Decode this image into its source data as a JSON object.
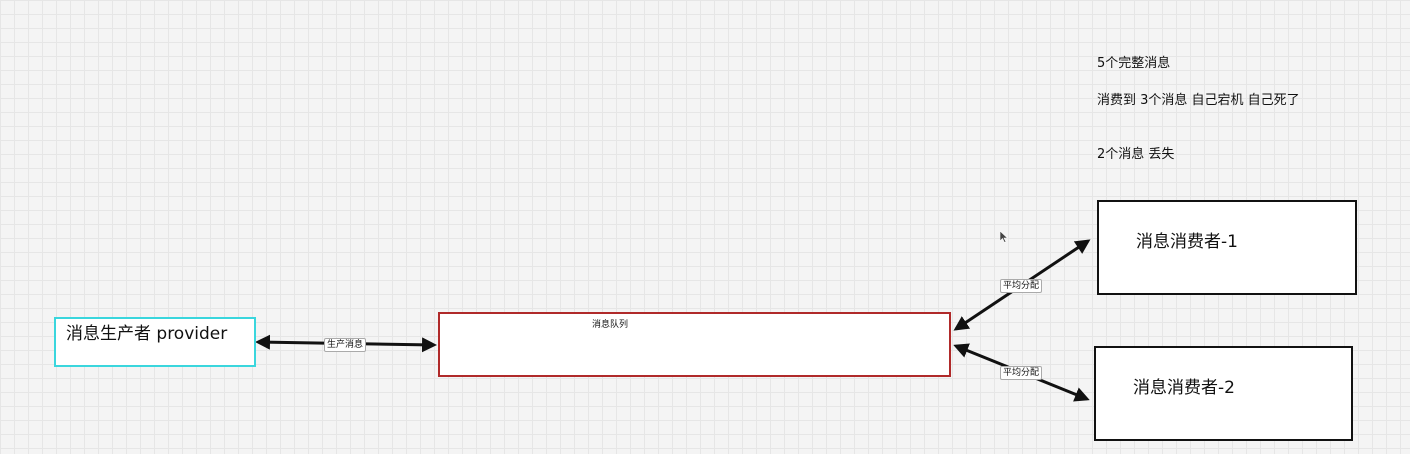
{
  "diagram": {
    "nodes": {
      "provider": {
        "label": "消息生产者 provider",
        "border_color": "#3ad6dd"
      },
      "queue": {
        "label": "消息队列",
        "border_color": "#b02a2a"
      },
      "consumer1": {
        "label": "消息消费者-1",
        "border_color": "#111111"
      },
      "consumer2": {
        "label": "消息消费者-2",
        "border_color": "#111111"
      }
    },
    "edges": {
      "produce": {
        "label": "生产消息",
        "from": "provider",
        "to": "queue"
      },
      "distribute1": {
        "label": "平均分配",
        "from": "queue",
        "to": "consumer1"
      },
      "distribute2": {
        "label": "平均分配",
        "from": "queue",
        "to": "consumer2"
      }
    },
    "notes": [
      "5个完整消息",
      "消费到 3个消息  自己宕机 自己死了",
      "2个消息  丢失"
    ]
  },
  "icons": {
    "cursor": "mouse-pointer-icon"
  }
}
